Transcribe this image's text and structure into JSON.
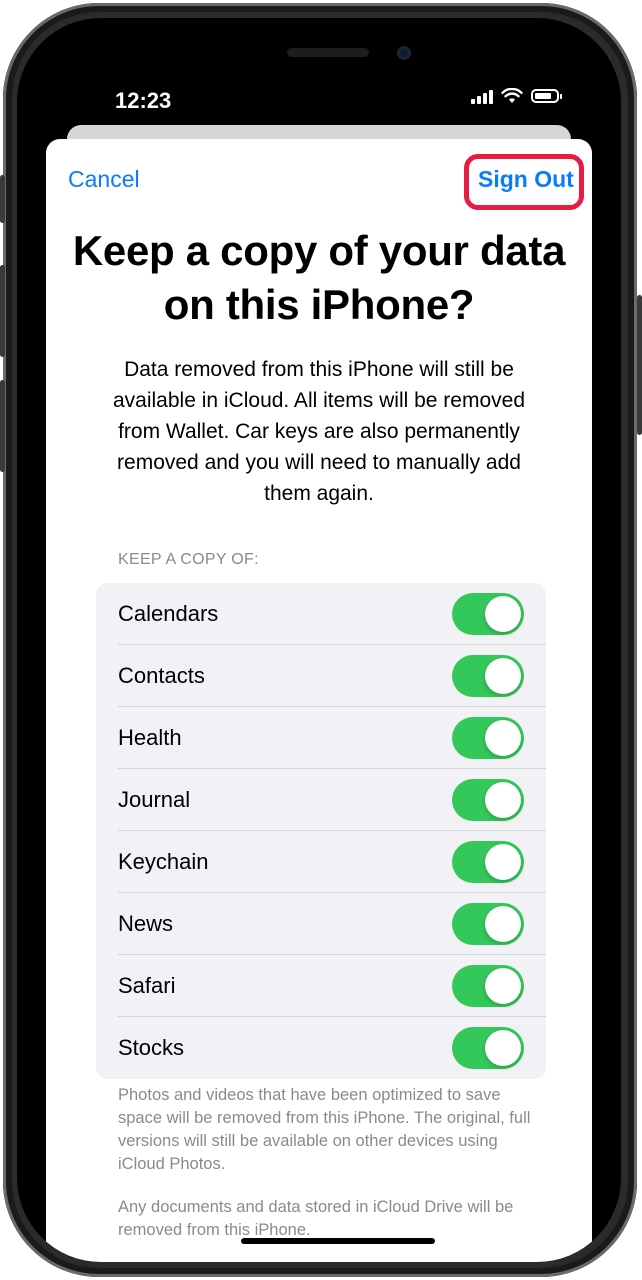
{
  "status_bar": {
    "time": "12:23"
  },
  "nav": {
    "cancel_label": "Cancel",
    "sign_out_label": "Sign Out"
  },
  "title": "Keep a copy of your data on this iPhone?",
  "description": "Data removed from this iPhone will still be available in iCloud. All items will be removed from Wallet. Car keys are also permanently removed and you will need to manually add them again.",
  "section_header": "KEEP A COPY OF:",
  "items": [
    {
      "label": "Calendars",
      "enabled": true
    },
    {
      "label": "Contacts",
      "enabled": true
    },
    {
      "label": "Health",
      "enabled": true
    },
    {
      "label": "Journal",
      "enabled": true
    },
    {
      "label": "Keychain",
      "enabled": true
    },
    {
      "label": "News",
      "enabled": true
    },
    {
      "label": "Safari",
      "enabled": true
    },
    {
      "label": "Stocks",
      "enabled": true
    }
  ],
  "footer_photos": "Photos and videos that have been optimized to save space will be removed from this iPhone. The original, full versions will still be available on other devices using iCloud Photos.",
  "footer_drive": "Any documents and data stored in iCloud Drive will be removed from this iPhone.",
  "colors": {
    "accent": "#0a7aff",
    "toggle_on": "#34c759",
    "highlight": "#e51d44"
  }
}
